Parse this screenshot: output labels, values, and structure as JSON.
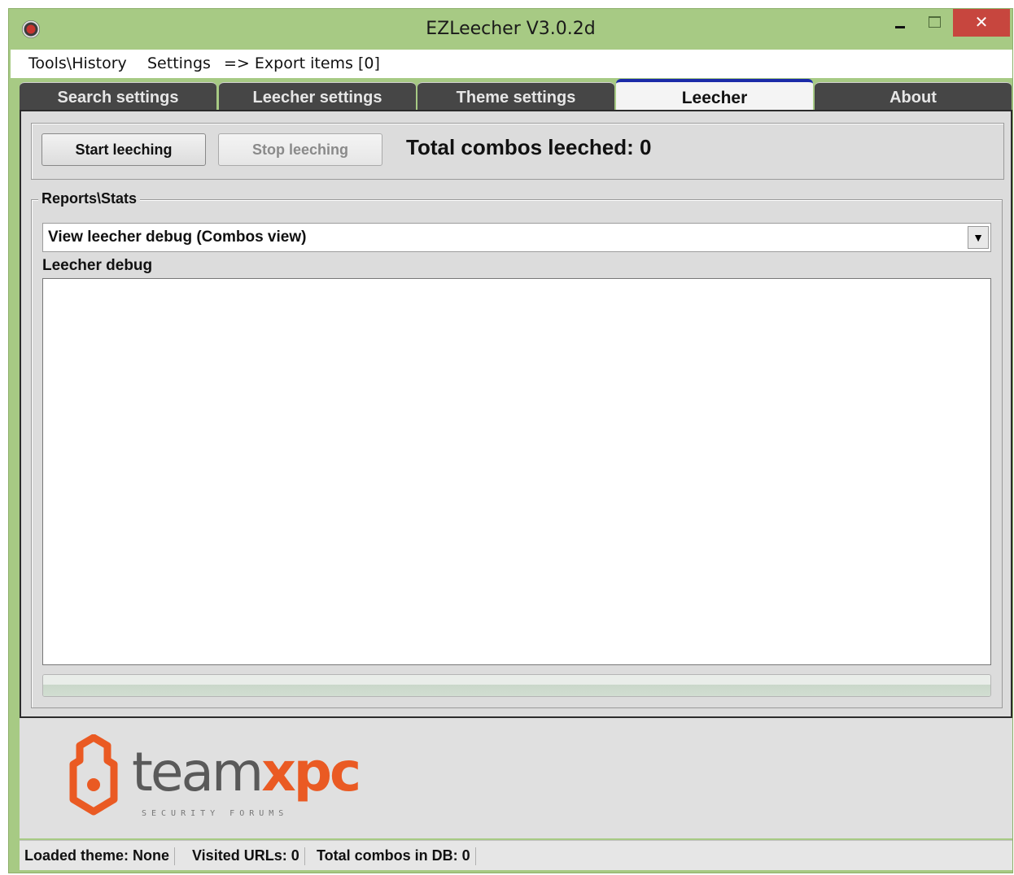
{
  "window": {
    "title": "EZLeecher V3.0.2d",
    "minimize_symbol": "–",
    "close_symbol": "✕"
  },
  "menu": {
    "items": [
      "Tools\\History",
      "Settings",
      "=> Export items [0]"
    ]
  },
  "tabs": [
    {
      "label": "Search settings",
      "active": false
    },
    {
      "label": "Leecher settings",
      "active": false
    },
    {
      "label": "Theme settings",
      "active": false
    },
    {
      "label": "Leecher",
      "active": true
    },
    {
      "label": "About",
      "active": false
    }
  ],
  "leecher": {
    "start_button": "Start leeching",
    "stop_button": "Stop leeching",
    "total_combos": "Total combos leeched: 0"
  },
  "reports": {
    "group_label": "Reports\\Stats",
    "view_select_value": "View leecher debug (Combos view)",
    "dropdown_arrow": "▼",
    "debug_label": "Leecher debug",
    "debug_text": "",
    "progress_percent": 100
  },
  "logo": {
    "brand_part1": "team",
    "brand_part2": "xpc",
    "tagline": "SECURITY FORUMS"
  },
  "status": {
    "theme": "Loaded theme: None",
    "visited": "Visited URLs: 0",
    "total_db": "Total combos in DB: 0"
  },
  "colors": {
    "titlebar": "#a7ca84",
    "close_button": "#c7463e",
    "tab_inactive": "#464646",
    "tab_active_accent": "#1a2aa8",
    "brand_orange": "#ea5a23"
  }
}
